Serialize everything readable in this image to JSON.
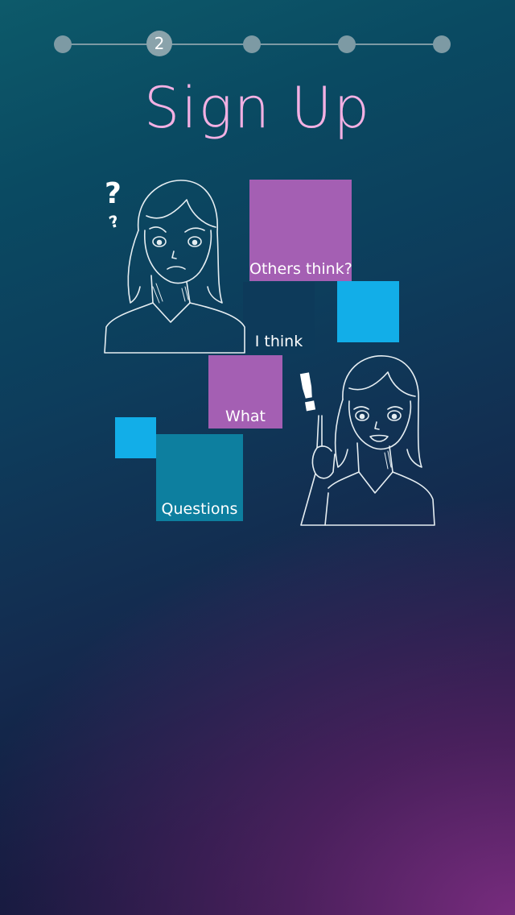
{
  "stepper": {
    "current_step": 2,
    "current_label": "2",
    "total_steps": 5
  },
  "page": {
    "title": "Sign Up"
  },
  "illustration": {
    "tiles": [
      {
        "label": "Others think?",
        "color": "#a45fb3"
      },
      {
        "label": "I think",
        "color": "#0d3a5a"
      },
      {
        "label": "What",
        "color": "#a45fb3"
      },
      {
        "label": "Questions",
        "color": "#0d7f9f"
      },
      {
        "label": "",
        "color": "#12aee8"
      },
      {
        "label": "",
        "color": "#12aee8"
      }
    ],
    "question_mark": "?",
    "exclamation_mark": "!"
  },
  "colors": {
    "title": "#f3b0e3",
    "stepper": "#7d9aa4",
    "line_art": "#e6eef2"
  }
}
